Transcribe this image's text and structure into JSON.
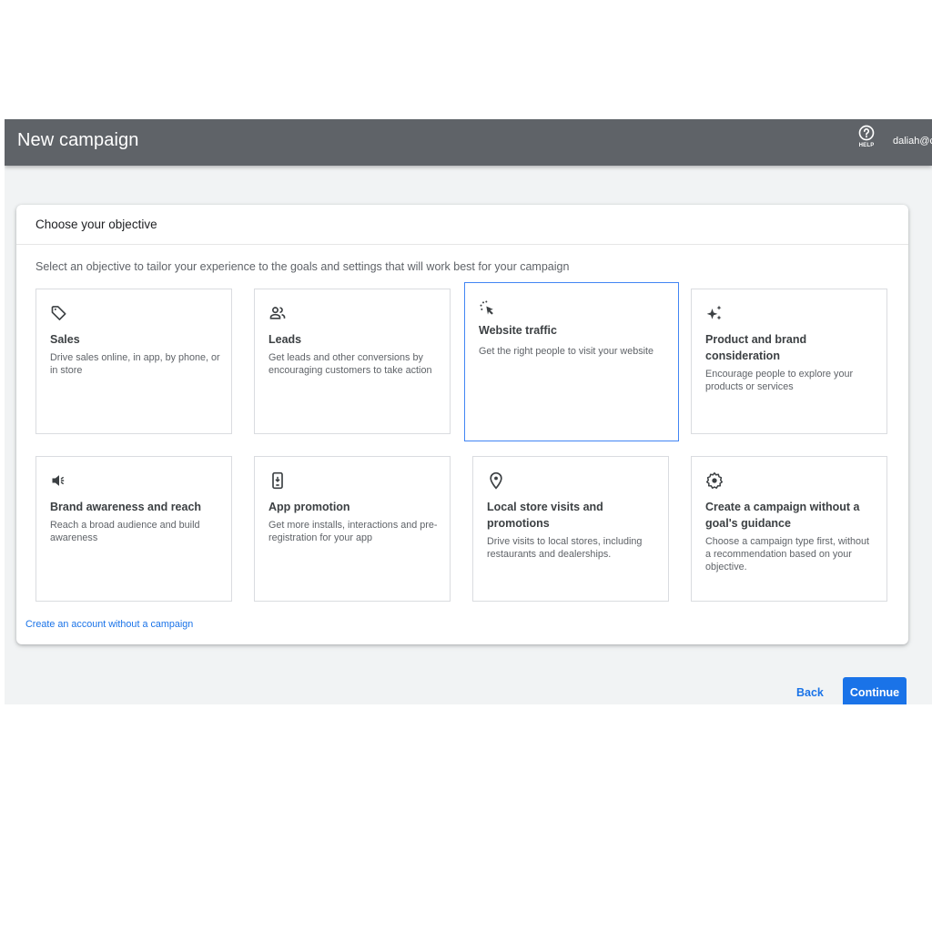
{
  "header": {
    "title": "New campaign",
    "help_label": "HELP",
    "account": "daliah@c"
  },
  "objective": {
    "heading": "Choose your objective",
    "intro": "Select an objective to tailor your experience to the goals and settings that will work best for your campaign",
    "tiles": [
      {
        "icon": "tag-icon",
        "title": "Sales",
        "description": "Drive sales online, in app, by phone, or in store",
        "selected": false
      },
      {
        "icon": "people-icon",
        "title": "Leads",
        "description": "Get leads and other conversions by encouraging customers to take action",
        "selected": false
      },
      {
        "icon": "cursor-click-icon",
        "title": "Website traffic",
        "description": "Get the right people to visit your website",
        "selected": true
      },
      {
        "icon": "sparkle-icon",
        "title": "Product and brand consideration",
        "description": "Encourage people to explore your products or services",
        "selected": false
      },
      {
        "icon": "megaphone-icon",
        "title": "Brand awareness and reach",
        "description": "Reach a broad audience and build awareness",
        "selected": false
      },
      {
        "icon": "phone-download-icon",
        "title": "App promotion",
        "description": "Get more installs, interactions and pre-registration for your app",
        "selected": false
      },
      {
        "icon": "location-pin-icon",
        "title": "Local store visits and promotions",
        "description": "Drive visits to local stores, including restaurants and dealerships.",
        "selected": false
      },
      {
        "icon": "gear-icon",
        "title": "Create a campaign without a goal's guidance",
        "description": "Choose a campaign type first, without a recommendation based on your objective.",
        "selected": false
      }
    ],
    "no_campaign_link": "Create an account without a campaign"
  },
  "footer": {
    "back_label": "Back",
    "continue_label": "Continue"
  },
  "colors": {
    "topbar": "#5f6368",
    "accent": "#1a73e8",
    "selected_border": "#4285f4",
    "background": "#f1f3f4"
  }
}
